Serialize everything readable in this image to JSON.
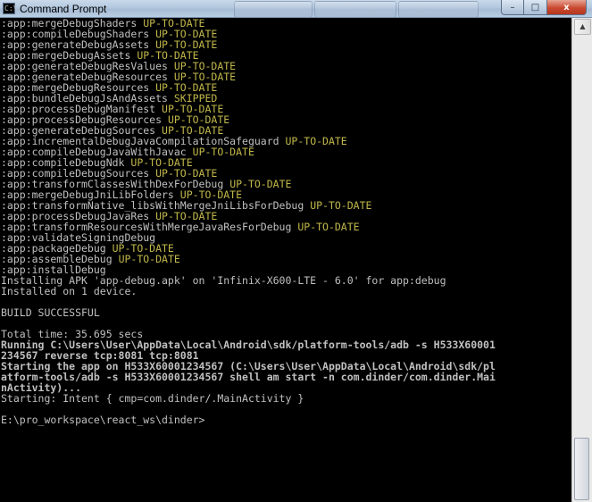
{
  "window": {
    "title": "Command Prompt",
    "icon_text": "C:\\",
    "buttons": {
      "minimize": "–",
      "maximize": "□",
      "close": "x"
    }
  },
  "console": {
    "lines": [
      {
        "text": ":app:mergeDebugShaders ",
        "status": "UP-TO-DATE"
      },
      {
        "text": ":app:compileDebugShaders ",
        "status": "UP-TO-DATE"
      },
      {
        "text": ":app:generateDebugAssets ",
        "status": "UP-TO-DATE"
      },
      {
        "text": ":app:mergeDebugAssets ",
        "status": "UP-TO-DATE"
      },
      {
        "text": ":app:generateDebugResValues ",
        "status": "UP-TO-DATE"
      },
      {
        "text": ":app:generateDebugResources ",
        "status": "UP-TO-DATE"
      },
      {
        "text": ":app:mergeDebugResources ",
        "status": "UP-TO-DATE"
      },
      {
        "text": ":app:bundleDebugJsAndAssets ",
        "status": "SKIPPED"
      },
      {
        "text": ":app:processDebugManifest ",
        "status": "UP-TO-DATE"
      },
      {
        "text": ":app:processDebugResources ",
        "status": "UP-TO-DATE"
      },
      {
        "text": ":app:generateDebugSources ",
        "status": "UP-TO-DATE"
      },
      {
        "text": ":app:incrementalDebugJavaCompilationSafeguard ",
        "status": "UP-TO-DATE"
      },
      {
        "text": ":app:compileDebugJavaWithJavac ",
        "status": "UP-TO-DATE"
      },
      {
        "text": ":app:compileDebugNdk ",
        "status": "UP-TO-DATE"
      },
      {
        "text": ":app:compileDebugSources ",
        "status": "UP-TO-DATE"
      },
      {
        "text": ":app:transformClassesWithDexForDebug ",
        "status": "UP-TO-DATE"
      },
      {
        "text": ":app:mergeDebugJniLibFolders ",
        "status": "UP-TO-DATE"
      },
      {
        "text": ":app:transformNative_libsWithMergeJniLibsForDebug ",
        "status": "UP-TO-DATE"
      },
      {
        "text": ":app:processDebugJavaRes ",
        "status": "UP-TO-DATE"
      },
      {
        "text": ":app:transformResourcesWithMergeJavaResForDebug ",
        "status": "UP-TO-DATE"
      },
      {
        "text": ":app:validateSigningDebug",
        "status": ""
      },
      {
        "text": ":app:packageDebug ",
        "status": "UP-TO-DATE"
      },
      {
        "text": ":app:assembleDebug ",
        "status": "UP-TO-DATE"
      },
      {
        "text": ":app:installDebug",
        "status": ""
      },
      {
        "text": "Installing APK 'app-debug.apk' on 'Infinix-X600-LTE - 6.0' for app:debug",
        "status": ""
      },
      {
        "text": "Installed on 1 device.",
        "status": ""
      },
      {
        "text": "",
        "status": ""
      },
      {
        "text": "BUILD SUCCESSFUL",
        "status": ""
      },
      {
        "text": "",
        "status": ""
      },
      {
        "text": "Total time: 35.695 secs",
        "status": ""
      },
      {
        "text": "Running C:\\Users\\User\\AppData\\Local\\Android\\sdk/platform-tools/adb -s H533X60001",
        "status": "",
        "bold": true
      },
      {
        "text": "234567 reverse tcp:8081 tcp:8081",
        "status": "",
        "bold": true
      },
      {
        "text": "Starting the app on H533X60001234567 (C:\\Users\\User\\AppData\\Local\\Android\\sdk/pl",
        "status": "",
        "bold": true
      },
      {
        "text": "atform-tools/adb -s H533X60001234567 shell am start -n com.dinder/com.dinder.Mai",
        "status": "",
        "bold": true
      },
      {
        "text": "nActivity)...",
        "status": "",
        "bold": true
      },
      {
        "text": "Starting: Intent { cmp=com.dinder/.MainActivity }",
        "status": ""
      },
      {
        "text": "",
        "status": ""
      },
      {
        "text": "E:\\pro_workspace\\react_ws\\dinder>",
        "status": ""
      }
    ]
  }
}
